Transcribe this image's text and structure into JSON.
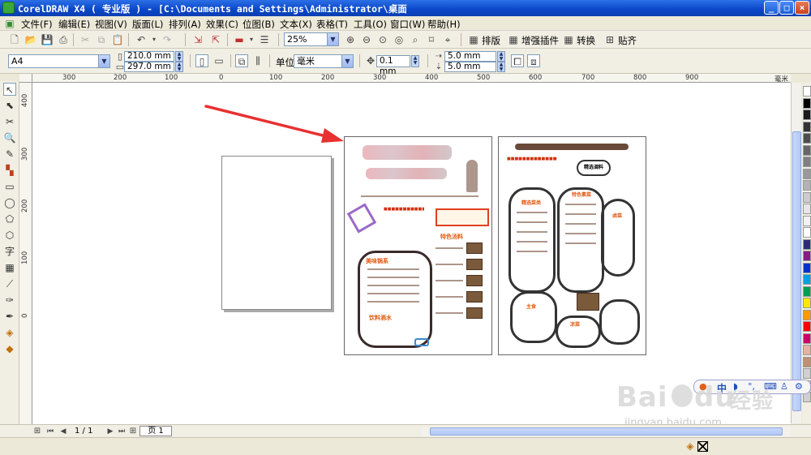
{
  "titlebar": {
    "title": "CorelDRAW X4 ( 专业版 ) - [C:\\Documents and Settings\\Administrator\\桌面",
    "minimize": "_",
    "maximize": "□",
    "close": "×"
  },
  "menubar": {
    "items": [
      "文件(F)",
      "编辑(E)",
      "视图(V)",
      "版面(L)",
      "排列(A)",
      "效果(C)",
      "位图(B)",
      "文本(X)",
      "表格(T)",
      "工具(O)",
      "窗口(W)",
      "帮助(H)"
    ]
  },
  "toolbar": {
    "zoom_value": "25%",
    "layout_label": "排版",
    "plugin_label": "增强插件",
    "convert_label": "转换",
    "snap_label": "贴齐"
  },
  "propbar": {
    "paper_size": "A4",
    "width": "210.0 mm",
    "height": "297.0 mm",
    "unit_label": "单位:",
    "unit_value": "毫米",
    "nudge": "0.1 mm",
    "dup_x": "5.0 mm",
    "dup_y": "5.0 mm"
  },
  "rulers": {
    "h_unit": "毫米",
    "h_ticks": [
      "300",
      "200",
      "100",
      "0",
      "100",
      "200",
      "300",
      "400",
      "500",
      "600",
      "700",
      "800",
      "900"
    ],
    "v_ticks": [
      "400",
      "300",
      "200",
      "100",
      "0"
    ]
  },
  "page_nav": {
    "page_count": "1 / 1",
    "page_tab": "页 1"
  },
  "menu_page": {
    "section_titles": [
      "美味锅系",
      "特色汤料",
      "特色素菜",
      "精选菜类",
      "饮料酒水",
      "主食",
      "凉菜",
      "卤菜",
      "精选调料"
    ]
  },
  "watermark": {
    "brand": "Bai",
    "brand2": "du",
    "jingyan": "经验",
    "url": "jingyan.baidu.com"
  },
  "ime": {
    "lang": "中"
  },
  "palette": {
    "colors": [
      "#ffffff",
      "#000000",
      "#1a1a1a",
      "#333333",
      "#4d4d4d",
      "#666666",
      "#808080",
      "#999999",
      "#b3b3b3",
      "#cccccc",
      "#e6e6e6",
      "#f2f2f2",
      "#ffffff",
      "#2b2b7a",
      "#8a1a8a",
      "#0033cc",
      "#00a0e6",
      "#00a050",
      "#ffe600",
      "#ff9900",
      "#ff0000",
      "#cc0066",
      "#e8b0a0",
      "#c09070",
      "#d0d0d0",
      "#eeeeee",
      "#cfcfcf"
    ]
  }
}
